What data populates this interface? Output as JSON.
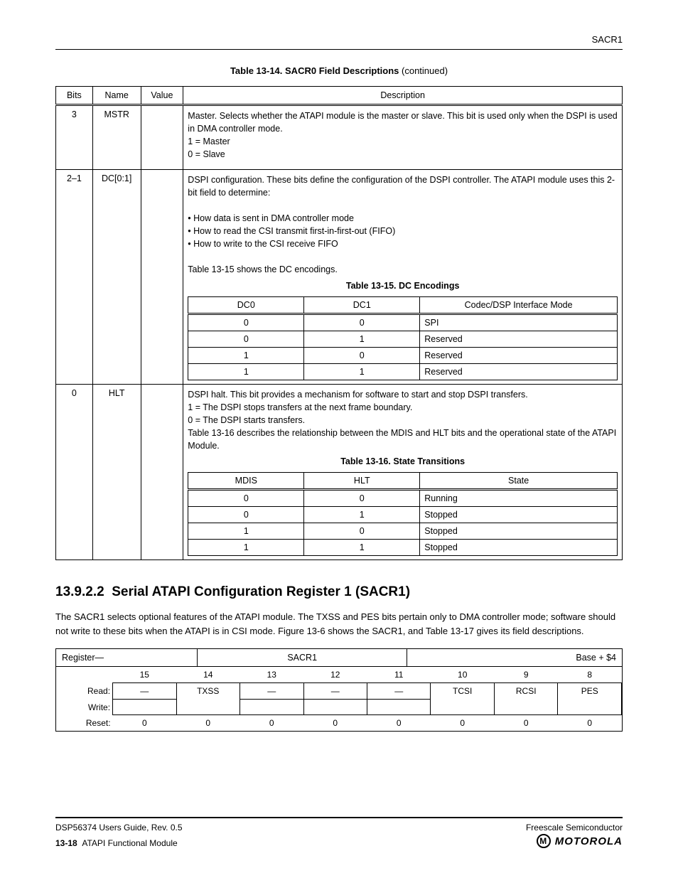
{
  "header": {
    "right": "SACR1"
  },
  "table1": {
    "title_prefix": "Table 13-14. SACR0 Field Descriptions",
    "title_suffix": "(continued)",
    "cols": [
      "Bits",
      "Name",
      "Value",
      "Description"
    ],
    "rows": [
      {
        "bits": "3",
        "name": "MSTR",
        "value": "",
        "desc": "Master. Selects whether the ATAPI module is the master or slave. This bit is used only when the DSPI is used in DMA controller mode.\n1 = Master\n0 = Slave"
      },
      {
        "bits": "2–1",
        "name": "DC[0:1]",
        "value": "",
        "desc": "DSPI configuration. These bits define the configuration of the DSPI controller. The ATAPI module uses this 2-bit field to determine:\n\n• How data is sent in DMA controller mode\n• How to read the CSI transmit first-in-first-out (FIFO)\n• How to write to the CSI receive FIFO\n\nTable 13-15 shows the DC encodings.",
        "sub": {
          "title": "Table 13-15. DC Encodings",
          "cols": [
            "DC0",
            "DC1",
            "Codec/DSP Interface Mode"
          ],
          "data": [
            [
              "0",
              "0",
              "SPI"
            ],
            [
              "0",
              "1",
              "Reserved"
            ],
            [
              "1",
              "0",
              "Reserved"
            ],
            [
              "1",
              "1",
              "Reserved"
            ]
          ]
        }
      },
      {
        "bits": "0",
        "name": "HLT",
        "value": "",
        "desc": "DSPI halt. This bit provides a mechanism for software to start and stop DSPI transfers.\n1 = The DSPI stops transfers at the next frame boundary.\n0 = The DSPI starts transfers.\nTable 13-16 describes the relationship between the MDIS and HLT bits and the operational state of the ATAPI Module.",
        "sub": {
          "title": "Table 13-16. State Transitions",
          "cols": [
            "MDIS",
            "HLT",
            "State"
          ],
          "data": [
            [
              "0",
              "0",
              "Running"
            ],
            [
              "0",
              "1",
              "Stopped"
            ],
            [
              "1",
              "0",
              "Stopped"
            ],
            [
              "1",
              "1",
              "Stopped"
            ]
          ]
        }
      }
    ]
  },
  "section": {
    "num": "13.9.2.2",
    "title": "Serial ATAPI Configuration Register 1 (SACR1)",
    "para": "The SACR1 selects optional features of the ATAPI module. The TXSS and PES bits pertain only to DMA controller mode; software should not write to these bits when the ATAPI is in CSI mode. Figure 13-6 shows the SACR1, and Table 13-17 gives its field descriptions."
  },
  "reg": {
    "labels": {
      "register": "Register—",
      "base": "Base + $4"
    },
    "bitnums": [
      "15",
      "14",
      "13",
      "12",
      "11",
      "10",
      "9",
      "8"
    ],
    "fields": [
      "—",
      "TXSS",
      "—",
      "—",
      "—",
      "TCSI",
      "RCSI",
      "PES"
    ],
    "resets": [
      "0",
      "0",
      "0",
      "0",
      "0",
      "0",
      "0",
      "0"
    ],
    "row_labels": {
      "read": "Read:",
      "write": "Write:",
      "reset": "Reset:"
    }
  },
  "footer": {
    "left_top": "DSP56374 Users Guide, Rev. 0.5",
    "right_top": "Freescale Semiconductor",
    "left_bot_bold": "13-18",
    "left_bot_tail": "ATAPI Functional Module"
  }
}
